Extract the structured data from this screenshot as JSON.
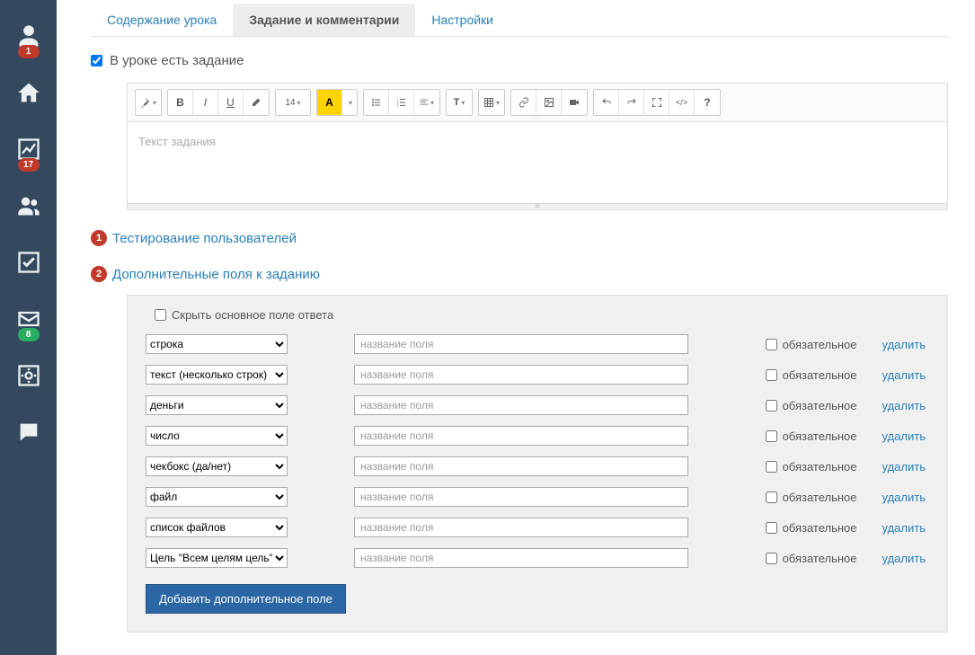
{
  "sidebar": {
    "items": [
      {
        "icon": "profile-icon",
        "badge": "1",
        "badge_color": "red"
      },
      {
        "icon": "home-icon"
      },
      {
        "icon": "chart-icon",
        "badge": "17",
        "badge_color": "red"
      },
      {
        "icon": "users-icon"
      },
      {
        "icon": "check-icon"
      },
      {
        "icon": "mail-icon",
        "badge": "8",
        "badge_color": "green"
      },
      {
        "icon": "settings-icon"
      },
      {
        "icon": "chat-icon"
      }
    ]
  },
  "tabs": [
    {
      "label": "Содержание урока",
      "active": false
    },
    {
      "label": "Задание и комментарии",
      "active": true
    },
    {
      "label": "Настройки",
      "active": false
    }
  ],
  "lesson_has_task": {
    "label": "В уроке есть задание",
    "checked": true
  },
  "editor": {
    "placeholder": "Текст задания",
    "fontsize_label": "14",
    "a_label": "A"
  },
  "links": [
    {
      "num": "1",
      "text": "Тестирование пользователей"
    },
    {
      "num": "2",
      "text": "Дополнительные поля к заданию"
    }
  ],
  "fields_panel": {
    "hide_main_label": "Скрыть основное поле ответа",
    "hide_main_checked": false,
    "name_placeholder": "название поля",
    "required_label": "обязательное",
    "delete_label": "удалить",
    "add_button": "Добавить дополнительное поле",
    "rows": [
      {
        "type": "строка"
      },
      {
        "type": "текст (несколько строк)"
      },
      {
        "type": "деньги"
      },
      {
        "type": "число"
      },
      {
        "type": "чекбокс (да/нет)"
      },
      {
        "type": "файл"
      },
      {
        "type": "список файлов"
      },
      {
        "type": "Цель \"Всем целям цель\""
      }
    ]
  }
}
